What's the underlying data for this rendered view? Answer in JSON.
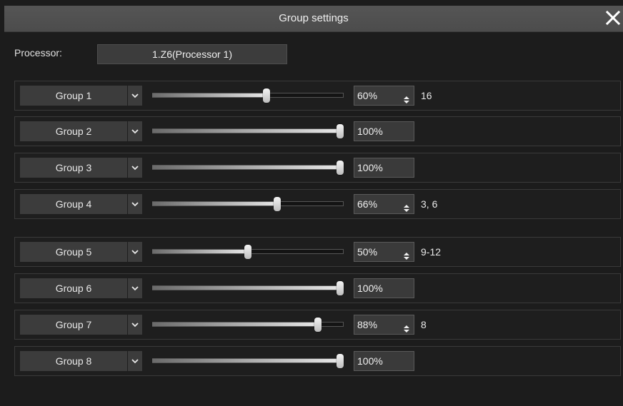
{
  "window": {
    "title": "Group settings"
  },
  "processor": {
    "label": "Processor:",
    "value": "1.Z6(Processor 1)"
  },
  "groups": [
    {
      "name": "Group 1",
      "level": 60,
      "value_text": "60%",
      "channels": "16",
      "has_spinner": true
    },
    {
      "name": "Group 2",
      "level": 100,
      "value_text": "100%",
      "channels": "",
      "has_spinner": false
    },
    {
      "name": "Group 3",
      "level": 100,
      "value_text": "100%",
      "channels": "",
      "has_spinner": false
    },
    {
      "name": "Group 4",
      "level": 66,
      "value_text": "66%",
      "channels": "3, 6",
      "has_spinner": true
    },
    {
      "name": "Group 5",
      "level": 50,
      "value_text": "50%",
      "channels": "9-12",
      "has_spinner": true
    },
    {
      "name": "Group 6",
      "level": 100,
      "value_text": "100%",
      "channels": "",
      "has_spinner": false
    },
    {
      "name": "Group 7",
      "level": 88,
      "value_text": "88%",
      "channels": "8",
      "has_spinner": true
    },
    {
      "name": "Group 8",
      "level": 100,
      "value_text": "100%",
      "channels": "",
      "has_spinner": false
    }
  ],
  "icons": {
    "close": "close-icon",
    "dropdown": "chevron-down-icon",
    "spinner": "spinner-arrows-icon"
  },
  "colors": {
    "background": "#1c1c1c",
    "titlebar": "#4f4f4f",
    "field": "#3c3c3c",
    "text": "#e8e8e8"
  }
}
